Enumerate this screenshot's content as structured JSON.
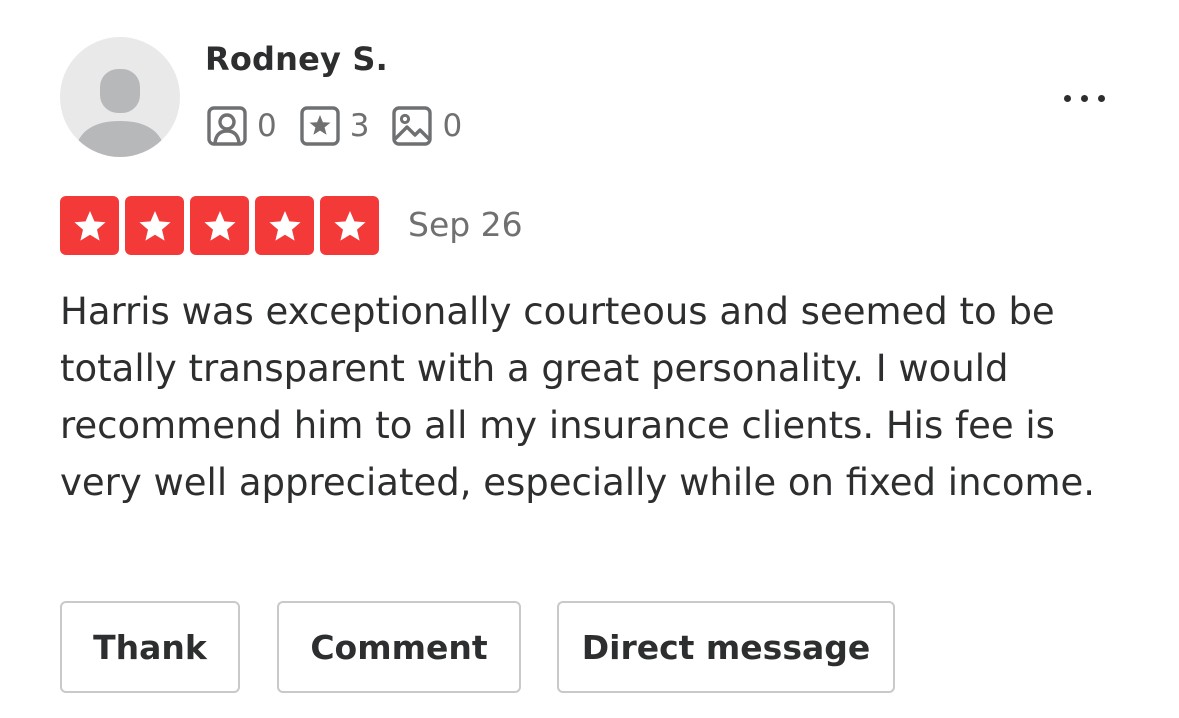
{
  "review": {
    "user": {
      "name": "Rodney S.",
      "friends_count": "0",
      "reviews_count": "3",
      "photos_count": "0"
    },
    "rating": 5,
    "rating_max": 5,
    "date": "Sep 26",
    "text": "Harris was exceptionally courteous and seemed to be totally transparent with a great personality. I would recommend him to all my insurance clients. His fee is very well appreciated, especially while on fixed income."
  },
  "actions": {
    "thank_label": "Thank",
    "comment_label": "Comment",
    "message_label": "Direct message"
  },
  "icons": {
    "avatar": "user-silhouette-icon",
    "friends": "friends-icon",
    "reviews": "review-star-icon",
    "photos": "photo-icon",
    "menu": "more-horizontal-icon"
  },
  "colors": {
    "star_background": "#f43939",
    "text_primary": "#2d2e2f",
    "text_secondary": "#6e7072",
    "button_border": "#c8c9ca",
    "avatar_background": "#e9e9ea"
  }
}
